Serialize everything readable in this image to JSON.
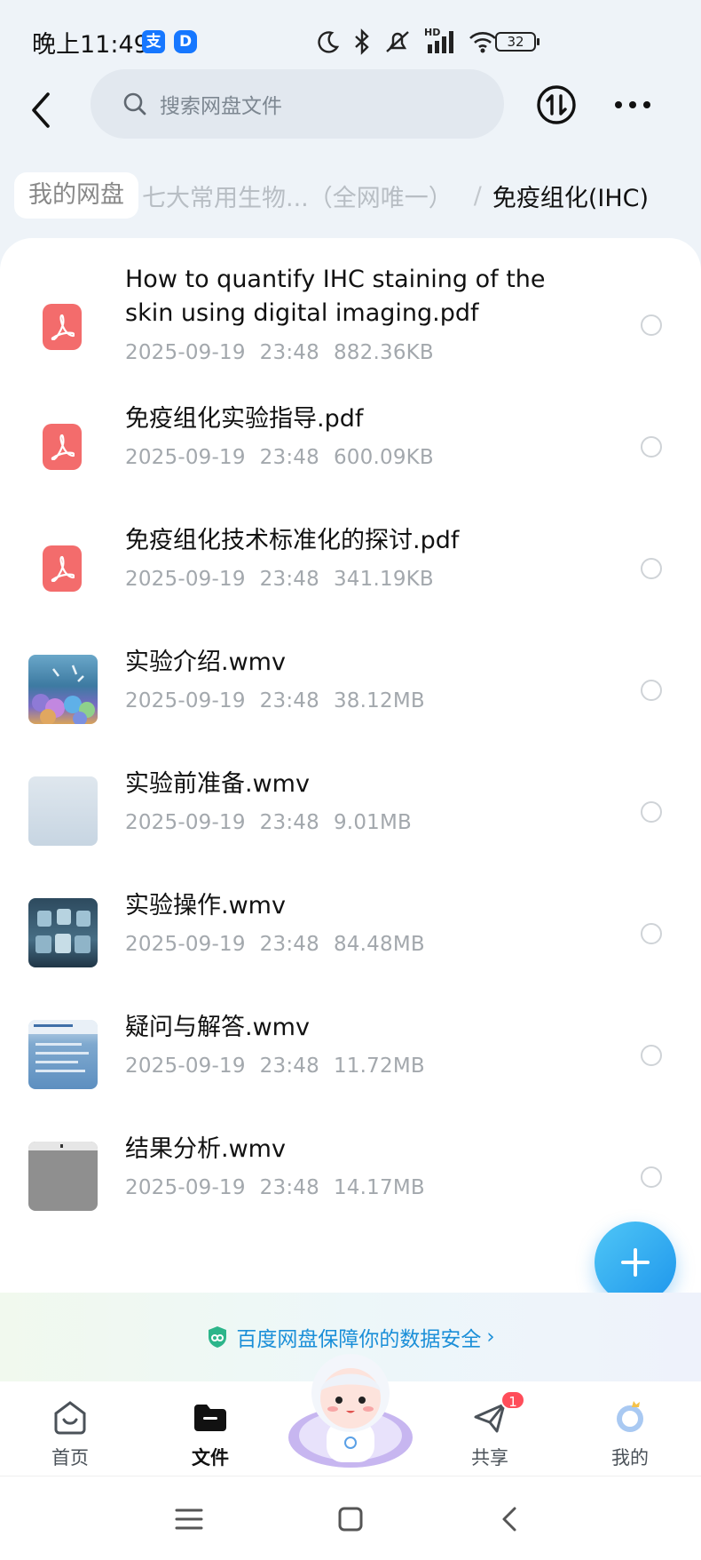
{
  "status_bar": {
    "time": "晚上11:49",
    "badge_alipay": "支",
    "badge_app": "D",
    "signal_label": "HD",
    "battery": "32"
  },
  "header": {
    "search_placeholder": "搜索网盘文件"
  },
  "breadcrumb": {
    "root": "我的网盘",
    "middle": "七大常用生物...（全网唯一）",
    "separator": "/",
    "current": "免疫组化(IHC)"
  },
  "files": [
    {
      "name_line1": "How to quantify IHC staining of the",
      "name_line2": "skin using digital imaging.pdf",
      "date": "2025-09-19",
      "time": "23:48",
      "size": "882.36KB",
      "type": "pdf-icon"
    },
    {
      "name": "免疫组化实验指导.pdf",
      "date": "2025-09-19",
      "time": "23:48",
      "size": "600.09KB",
      "type": "pdf-icon"
    },
    {
      "name": "免疫组化技术标准化的探讨.pdf",
      "date": "2025-09-19",
      "time": "23:48",
      "size": "341.19KB",
      "type": "pdf-icon"
    },
    {
      "name": "实验介绍.wmv",
      "date": "2025-09-19",
      "time": "23:48",
      "size": "38.12MB",
      "type": "video-thumbnail"
    },
    {
      "name": "实验前准备.wmv",
      "date": "2025-09-19",
      "time": "23:48",
      "size": "9.01MB",
      "type": "video-thumbnail"
    },
    {
      "name": "实验操作.wmv",
      "date": "2025-09-19",
      "time": "23:48",
      "size": "84.48MB",
      "type": "video-thumbnail"
    },
    {
      "name": "疑问与解答.wmv",
      "date": "2025-09-19",
      "time": "23:48",
      "size": "11.72MB",
      "type": "video-thumbnail"
    },
    {
      "name": "结果分析.wmv",
      "date": "2025-09-19",
      "time": "23:48",
      "size": "14.17MB",
      "type": "video-thumbnail"
    }
  ],
  "security_banner": {
    "text": "百度网盘保障你的数据安全",
    "chevron": "›"
  },
  "tabbar": {
    "home": "首页",
    "files": "文件",
    "share": "共享",
    "share_badge": "1",
    "me": "我的"
  },
  "colors": {
    "accent": "#1e96ec",
    "pdf_red": "#f36c6c",
    "badge_red": "#ff4d5a"
  }
}
